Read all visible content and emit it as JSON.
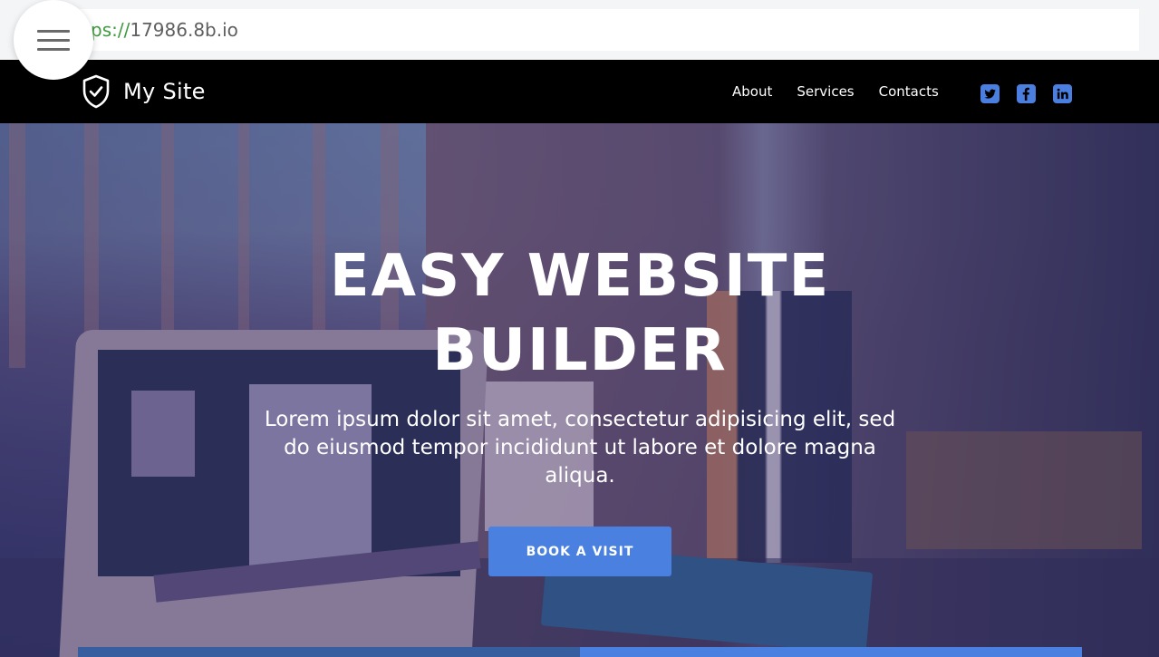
{
  "browser": {
    "url_scheme": "ps://",
    "url_host": "17986.8b.io",
    "menu_icon": "hamburger-menu-icon"
  },
  "navbar": {
    "brand_icon": "shield-check-icon",
    "brand_name": "My Site",
    "links": [
      {
        "label": "About"
      },
      {
        "label": "Services"
      },
      {
        "label": "Contacts"
      }
    ],
    "socials": [
      {
        "name": "twitter",
        "icon": "twitter-icon"
      },
      {
        "name": "facebook",
        "icon": "facebook-icon"
      },
      {
        "name": "linkedin",
        "icon": "linkedin-icon"
      }
    ]
  },
  "hero": {
    "title_line1": "EASY WEBSITE",
    "title_line2": "BUILDER",
    "subtitle": "Lorem ipsum dolor sit amet, consectetur adipisicing elit, sed do eiusmod tempor incididunt ut labore et dolore magna aliqua.",
    "cta_label": "BOOK A VISIT"
  },
  "colors": {
    "accent": "#4a80e0",
    "accent_dark": "#375f9f",
    "navbar_bg": "#000000",
    "url_scheme": "#3f9a3f"
  }
}
